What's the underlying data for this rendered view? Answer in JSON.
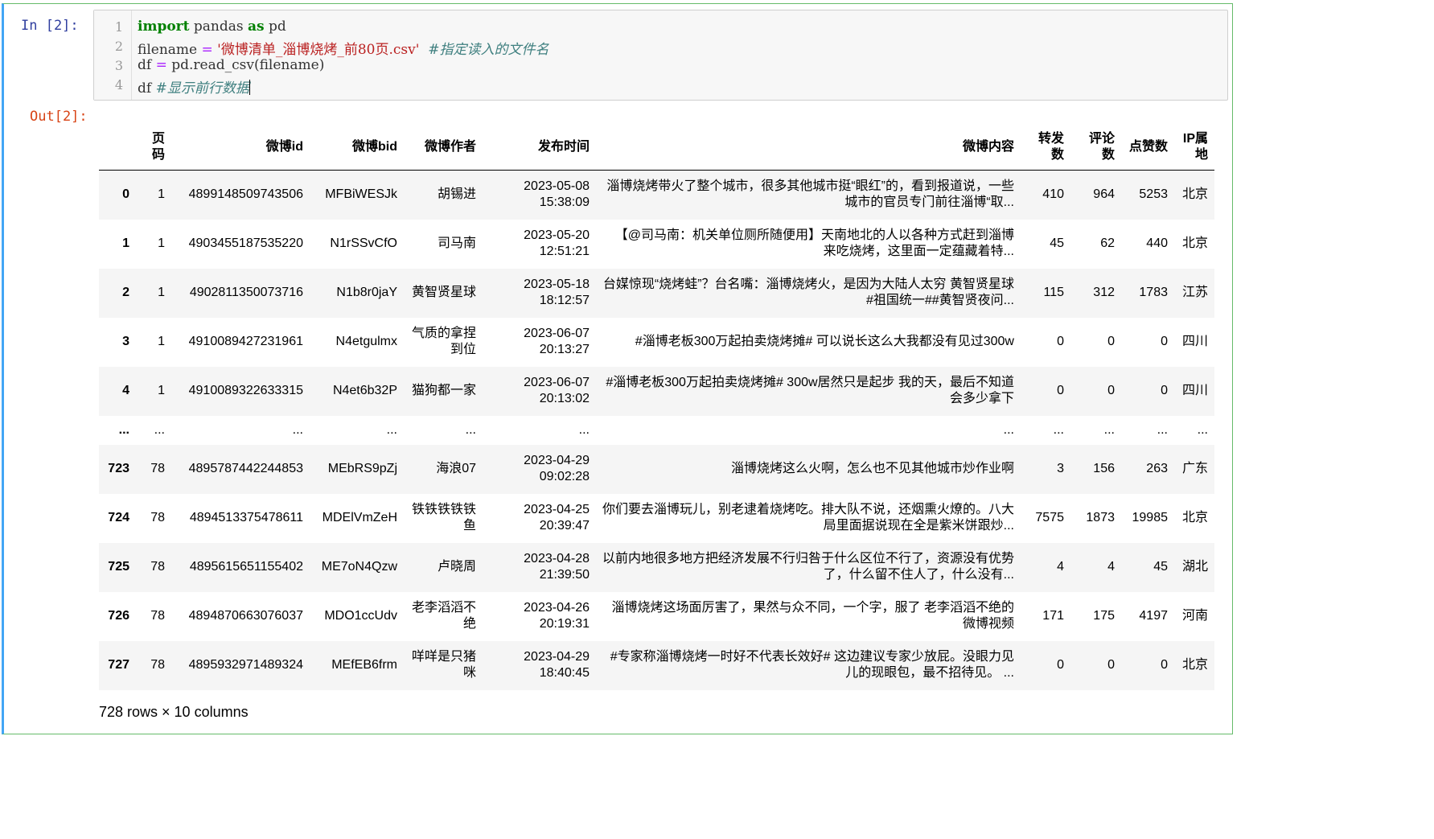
{
  "cell": {
    "in_prompt": "In  [2]:",
    "out_prompt": "Out[2]:"
  },
  "code": {
    "line_numbers": [
      "1",
      "2",
      "3",
      "4"
    ],
    "line1": {
      "kw1": "import",
      "mid": " pandas ",
      "kw2": "as",
      "tail": " pd"
    },
    "line2": {
      "name": "filename ",
      "op": "=",
      "sp": " ",
      "str": "'微博清单_淄博烧烤_前80页.csv'",
      "gap": "  ",
      "comment": "#指定读入的文件名"
    },
    "line3": {
      "name": "df ",
      "op": "=",
      "tail": " pd.read_csv(filename)"
    },
    "line4": {
      "name": "df ",
      "comment": "#显示前行数据"
    }
  },
  "table": {
    "columns": [
      "",
      "页码",
      "微博id",
      "微博bid",
      "微博作者",
      "发布时间",
      "微博内容",
      "转发数",
      "评论数",
      "点赞数",
      "IP属地"
    ],
    "rows": [
      [
        "0",
        "1",
        "4899148509743506",
        "MFBiWESJk",
        "胡锡进",
        "2023-05-08 15:38:09",
        "淄博烧烤带火了整个城市，很多其他城市挺“眼红”的，看到报道说，一些城市的官员专门前往淄博“取...",
        "410",
        "964",
        "5253",
        "北京"
      ],
      [
        "1",
        "1",
        "4903455187535220",
        "N1rSSvCfO",
        "司马南",
        "2023-05-20 12:51:21",
        "【@司马南：机关单位厕所随便用】天南地北的人以各种方式赶到淄博来吃烧烤，这里面一定蕴藏着特...",
        "45",
        "62",
        "440",
        "北京"
      ],
      [
        "2",
        "1",
        "4902811350073716",
        "N1b8r0jaY",
        "黄智贤星球",
        "2023-05-18 18:12:57",
        "台媒惊现“烧烤蛙”？台名嘴：淄博烧烤火，是因为大陆人太穷 黄智贤星球#祖国统一##黄智贤夜问...",
        "115",
        "312",
        "1783",
        "江苏"
      ],
      [
        "3",
        "1",
        "4910089427231961",
        "N4etgulmx",
        "气质的拿捏到位",
        "2023-06-07 20:13:27",
        "#淄博老板300万起拍卖烧烤摊# 可以说长这么大我都没有见过300w",
        "0",
        "0",
        "0",
        "四川"
      ],
      [
        "4",
        "1",
        "4910089322633315",
        "N4et6b32P",
        "猫狗都一家",
        "2023-06-07 20:13:02",
        "#淄博老板300万起拍卖烧烤摊# 300w居然只是起步 我的天，最后不知道会多少拿下",
        "0",
        "0",
        "0",
        "四川"
      ],
      [
        "...",
        "...",
        "...",
        "...",
        "...",
        "...",
        "...",
        "...",
        "...",
        "...",
        "..."
      ],
      [
        "723",
        "78",
        "4895787442244853",
        "MEbRS9pZj",
        "海浪07",
        "2023-04-29 09:02:28",
        "淄博烧烤这么火啊，怎么也不见其他城市炒作业啊",
        "3",
        "156",
        "263",
        "广东"
      ],
      [
        "724",
        "78",
        "4894513375478611",
        "MDElVmZeH",
        "铁铁铁铁铁鱼",
        "2023-04-25 20:39:47",
        "你们要去淄博玩儿，别老逮着烧烤吃。排大队不说，还烟熏火燎的。八大局里面据说现在全是紫米饼跟炒...",
        "7575",
        "1873",
        "19985",
        "北京"
      ],
      [
        "725",
        "78",
        "4895615651155402",
        "ME7oN4Qzw",
        "卢晓周",
        "2023-04-28 21:39:50",
        "以前内地很多地方把经济发展不行归咎于什么区位不行了，资源没有优势了，什么留不住人了，什么没有...",
        "4",
        "4",
        "45",
        "湖北"
      ],
      [
        "726",
        "78",
        "4894870663076037",
        "MDO1ccUdv",
        "老李滔滔不绝",
        "2023-04-26 20:19:31",
        "淄博烧烤这场面厉害了，果然与众不同，一个字，服了 老李滔滔不绝的微博视频",
        "171",
        "175",
        "4197",
        "河南"
      ],
      [
        "727",
        "78",
        "4895932971489324",
        "MEfEB6frm",
        "咩咩是只猪咪",
        "2023-04-29 18:40:45",
        "#专家称淄博烧烤一时好不代表长效好# 这边建议专家少放屁。没眼力见儿的现眼包，最不招待见。 ...",
        "0",
        "0",
        "0",
        "北京"
      ]
    ],
    "summary": "728 rows × 10 columns"
  }
}
